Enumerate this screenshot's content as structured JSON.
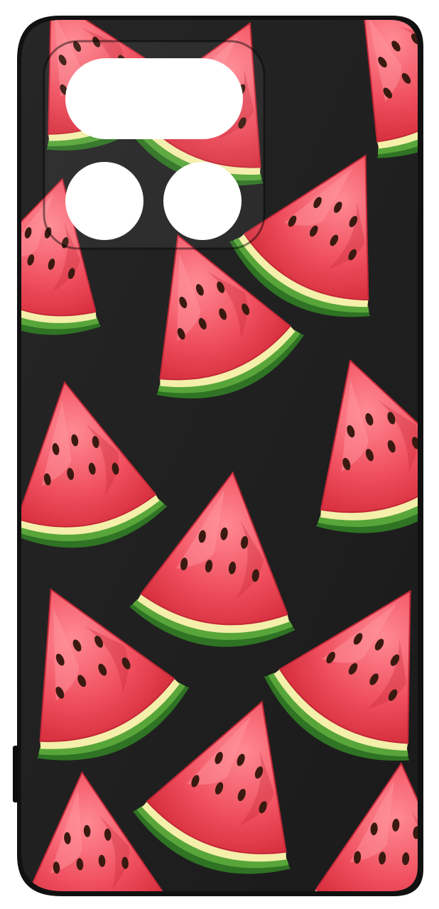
{
  "product": {
    "kind": "phone-case",
    "case_color": "#1e1e1e",
    "frame_color": "#111111",
    "pattern": "watermelon-slices"
  },
  "camera_module": {
    "cutouts": [
      "flash-pill",
      "lens-left",
      "lens-right"
    ],
    "cutout_color": "#ffffff"
  },
  "palette": {
    "flesh": "#f0505f",
    "flesh_light": "#ff8a93",
    "flesh_dark": "#d8313f",
    "pith": "#f4efaa",
    "rind": "#3f8a2c",
    "rind_dark": "#25551a",
    "seed": "#3a1a10"
  }
}
